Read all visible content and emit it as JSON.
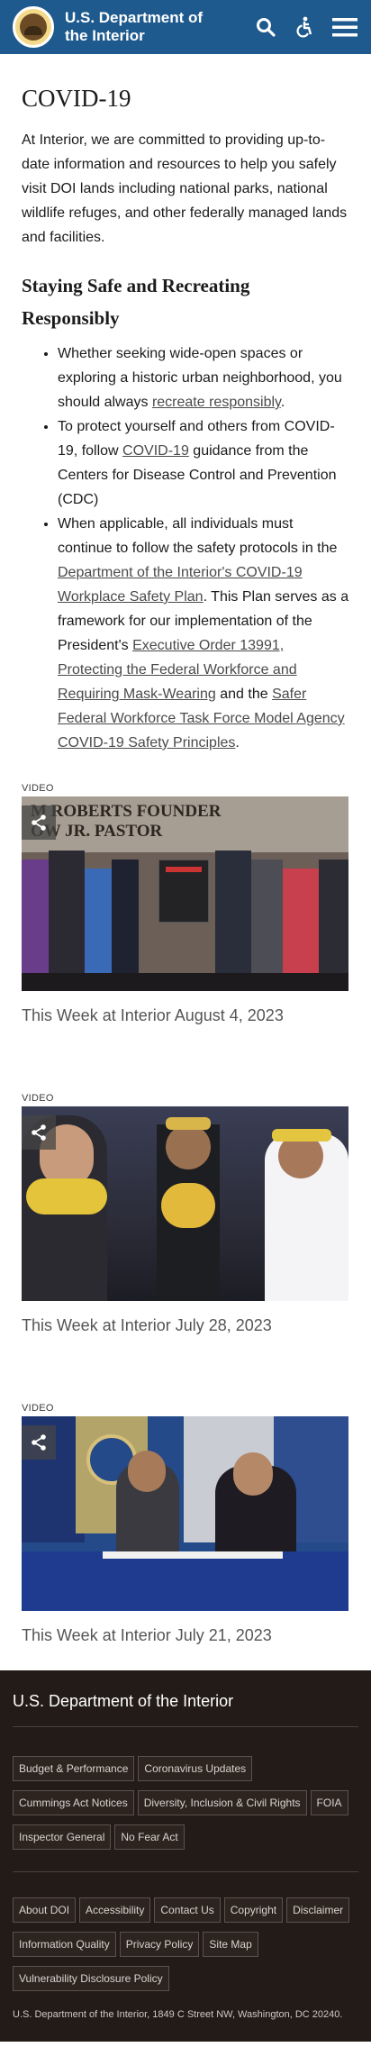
{
  "header": {
    "agency_name": "U.S. Department of the Interior",
    "icons": [
      "search-icon",
      "accessibility-icon",
      "menu-icon"
    ],
    "brand_color": "#1e5a8e"
  },
  "main": {
    "title": "COVID-19",
    "intro": "At Interior, we are committed to providing up-to-date information and resources to help you safely visit DOI lands including national parks, national wildlife refuges, and other federally managed lands and facilities.",
    "section_title": "Staying Safe and Recreating Responsibly",
    "bullet1": {
      "text": "Whether seeking wide-open spaces or exploring a historic urban neighborhood, you should always ",
      "link": "recreate responsibly",
      "end": "."
    },
    "bullet2": {
      "text": "To protect yourself and others from COVID-19, follow ",
      "link": "COVID-19",
      "end": " guidance from the Centers for Disease Control and Prevention (CDC)"
    },
    "bullet3": {
      "text": "When applicable, all individuals must continue to follow the safety protocols in the ",
      "link1": "Department of the Interior's COVID-19 Workplace Safety Plan",
      "text2": ". This Plan serves as a framework for our implementation of the President's ",
      "link2": "Executive Order 13991, Protecting the Federal Workforce and Requiring Mask-Wearing",
      "text3": " and the ",
      "link3": "Safer Federal Workforce Task Force Model Agency COVID-19 Safety Principles",
      "end": "."
    }
  },
  "videos": [
    {
      "label": "VIDEO",
      "title": "This Week at Interior August 4, 2023",
      "sign_text": "M ROBERTS FOUNDER\nOW JR. PASTOR"
    },
    {
      "label": "VIDEO",
      "title": "This Week at Interior July 28, 2023"
    },
    {
      "label": "VIDEO",
      "title": "This Week at Interior July 21, 2023"
    }
  ],
  "footer": {
    "title": "U.S. Department of the Interior",
    "links_group1": [
      "Budget & Performance",
      "Coronavirus Updates",
      "Cummings Act Notices",
      "Diversity, Inclusion & Civil Rights",
      "FOIA",
      "Inspector General",
      "No Fear Act"
    ],
    "links_group2": [
      "About DOI",
      "Accessibility",
      "Contact Us",
      "Copyright",
      "Disclaimer",
      "Information Quality",
      "Privacy Policy",
      "Site Map",
      "Vulnerability Disclosure Policy"
    ],
    "address": "U.S. Department of the Interior, 1849 C Street NW, Washington, DC 20240."
  }
}
